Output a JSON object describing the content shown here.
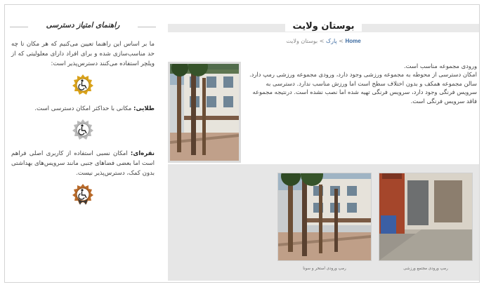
{
  "sidebar": {
    "title": "راهنمای امتیاز دسترسی",
    "intro": "ما بر اساس این راهنما تعیین می‌کنیم که هر مکان تا چه حد مناسب‌سازی شده و برای افراد دارای معلولیتی که از ویلچر استفاده می‌کنند دسترس‌پذیر است:",
    "gold_label": "طلایی:",
    "gold_text": " مکانی با حداکثر امکان دسترسی است.",
    "silver_label": "نقره‌ای:",
    "silver_text": " امکان نسبی استفاده از کاربری اصلی فراهم است اما بعضی فضاهای جنبی مانند سرویس‌های بهداشتی بدون کمک، دسترس‌پذیر نیست.",
    "badge_colors": {
      "gold": "#d9a21b",
      "silver": "#b9b9b9",
      "bronze": "#b86a2a"
    }
  },
  "header": {
    "title": "بوستان ولایت"
  },
  "breadcrumb": {
    "home": "Home",
    "separator": ">",
    "park": "پارک",
    "current": "بوستان ولایت"
  },
  "description": {
    "line1": "ورودی مجموعه مناسب است.",
    "line2": "امکان دسترسی از محوطه به مجموعه ورزشی وجود دارد، ورودی مجموعه ورزشی رمپ دارد. سالن مجموعه همکف و بدون اختلاف سطح است اما ورزش مناسب ندارد. دسترسی به سرویس فرنگی وجود دارد، سرویس فرنگی تهیه شده اما نصب نشده است. درنتیجه مجموعه فاقد سرویس فرنگی است."
  },
  "gallery": {
    "items": [
      {
        "caption": "رمپ ورودی مجتمع ورزشی"
      },
      {
        "caption": "رمپ ورودی استخر و سونا"
      }
    ]
  }
}
